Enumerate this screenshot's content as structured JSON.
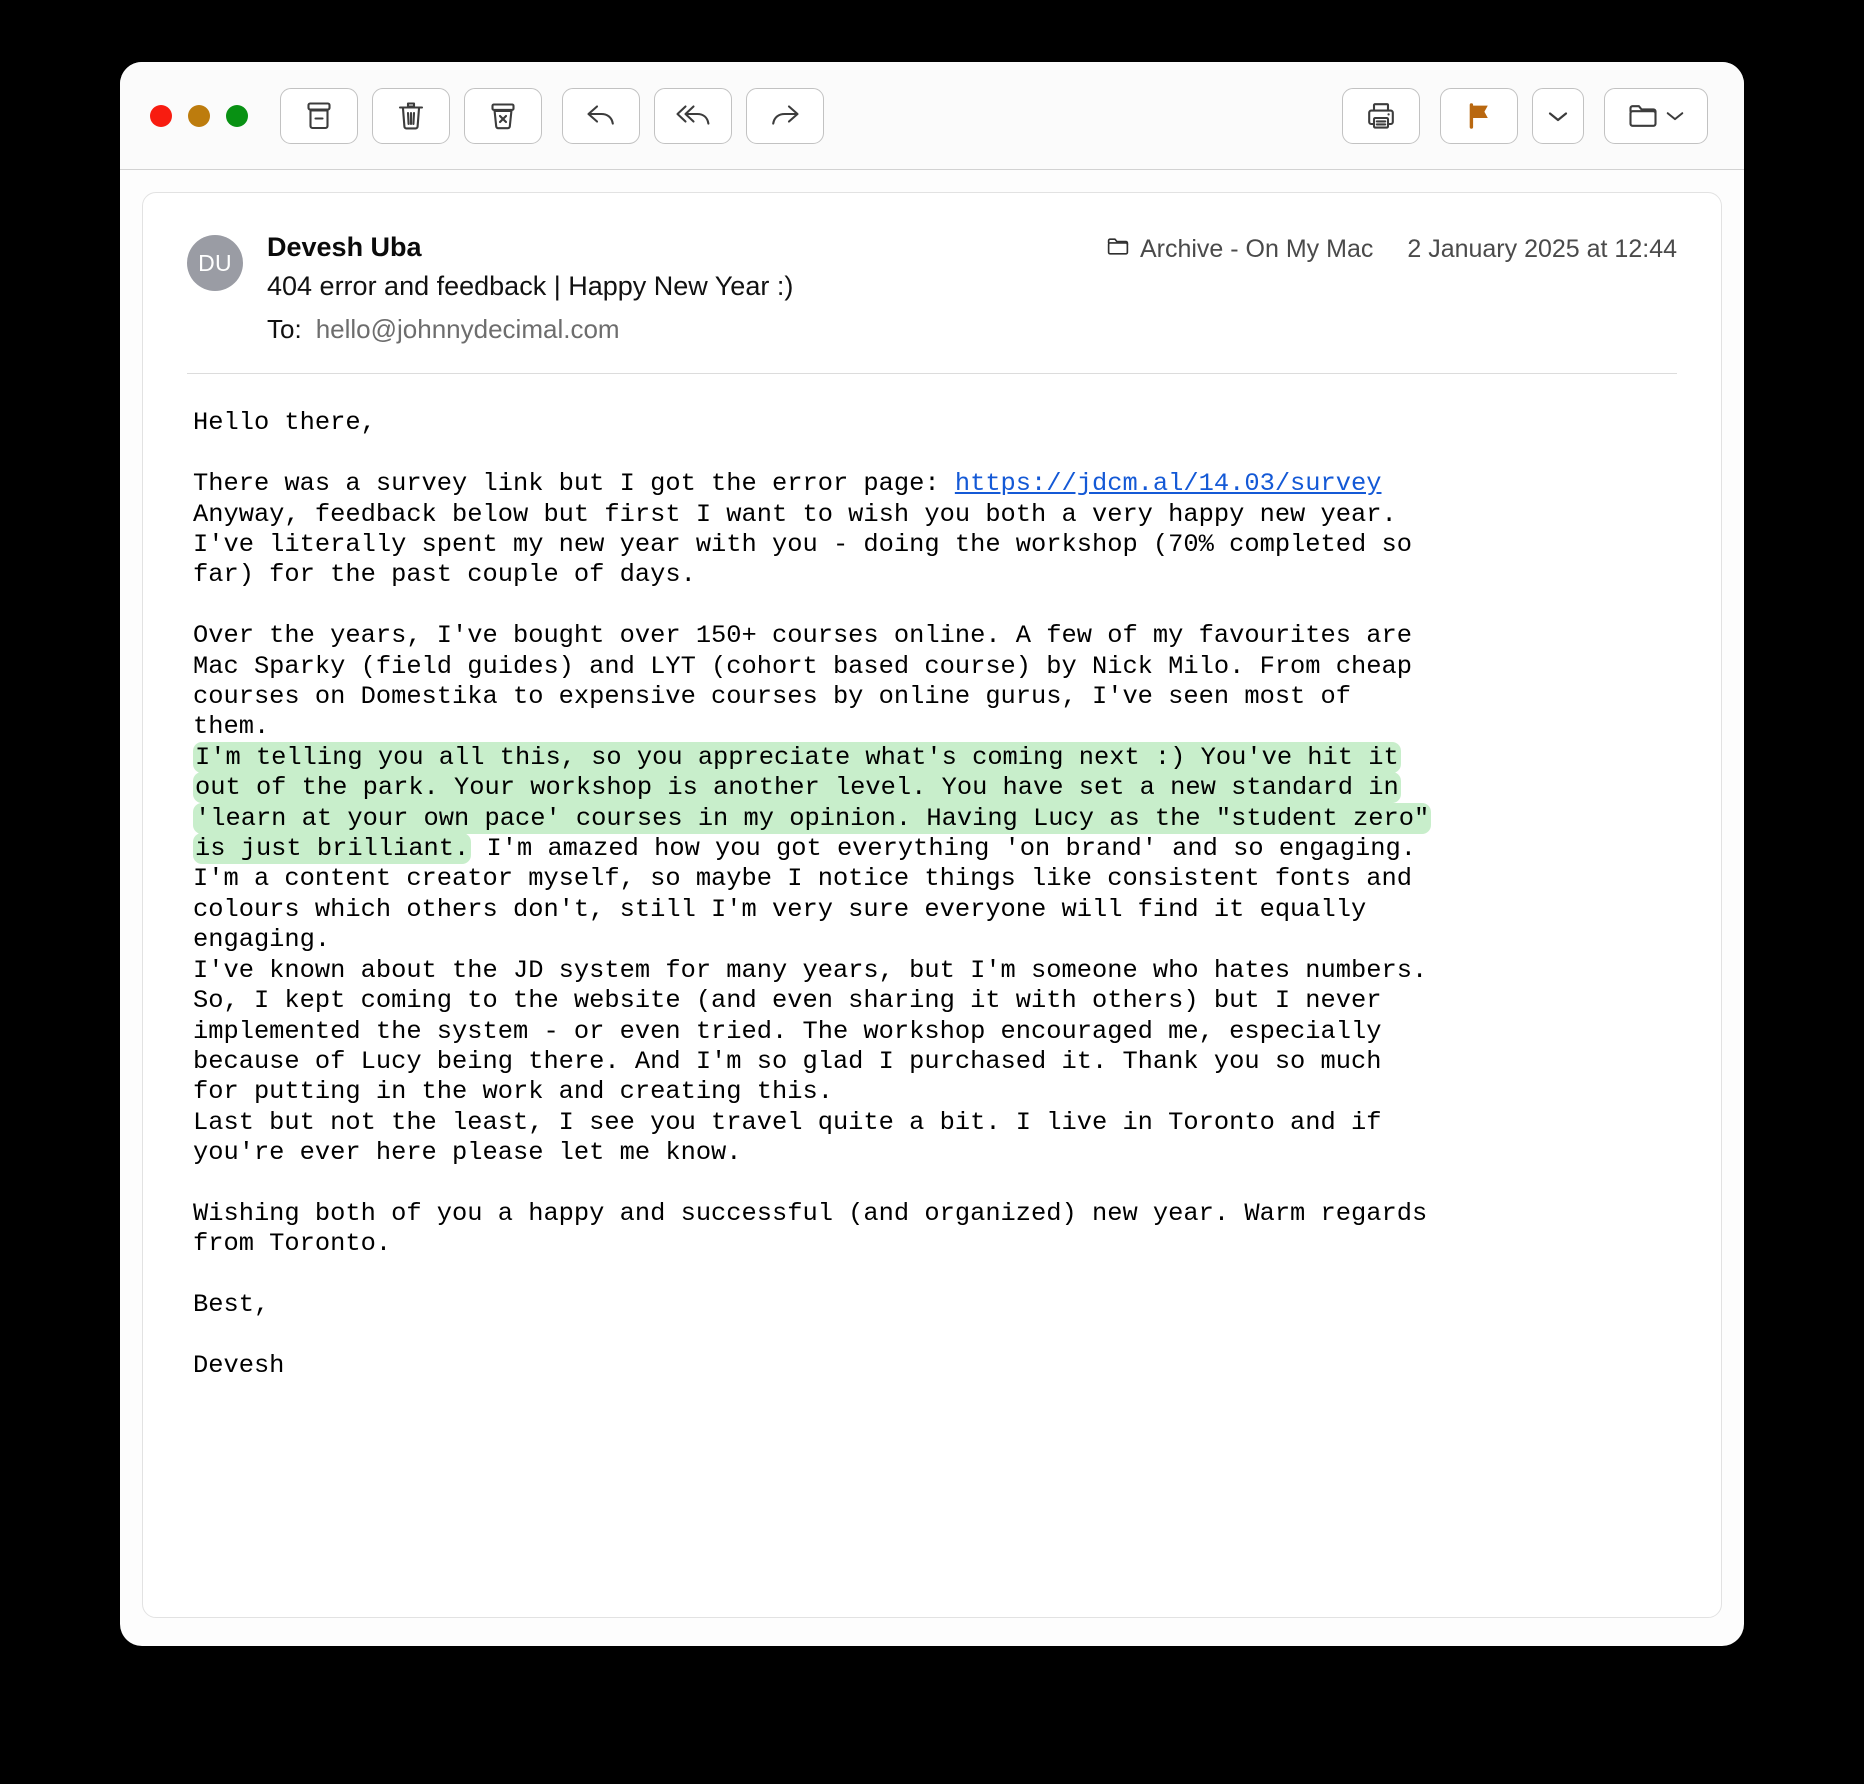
{
  "window": {
    "traffic_lights": [
      "close",
      "minimize",
      "zoom"
    ],
    "colors": {
      "close": "#f81c10",
      "minimize": "#bd7c0d",
      "zoom": "#089113",
      "flag": "#b96810",
      "link": "#1459d6",
      "highlight": "#c8eecb",
      "avatar": "#9a9ca4"
    }
  },
  "toolbar": {
    "left_buttons": [
      {
        "name": "archive",
        "label": "Archive",
        "icon": "archive-box-icon"
      },
      {
        "name": "delete",
        "label": "Delete",
        "icon": "trash-icon"
      },
      {
        "name": "junk",
        "label": "Move to Junk",
        "icon": "junk-bin-icon"
      },
      {
        "name": "reply",
        "label": "Reply",
        "icon": "reply-arrow-icon"
      },
      {
        "name": "reply-all",
        "label": "Reply All",
        "icon": "reply-all-arrow-icon"
      },
      {
        "name": "forward",
        "label": "Forward",
        "icon": "forward-arrow-icon"
      }
    ],
    "right_buttons": [
      {
        "name": "print",
        "label": "Print",
        "icon": "printer-icon"
      },
      {
        "name": "flag",
        "label": "Flag",
        "icon": "flag-icon"
      },
      {
        "name": "flag-menu",
        "label": "Flag options",
        "icon": "chevron-down-icon"
      },
      {
        "name": "move",
        "label": "Move to folder",
        "icon": "folder-icon"
      }
    ]
  },
  "message": {
    "avatar_initials": "DU",
    "sender": "Devesh Uba",
    "subject": "404 error and feedback | Happy New Year :)",
    "to_label": "To:",
    "to_address": "hello@johnnydecimal.com",
    "mailbox": "Archive - On My Mac",
    "mailbox_icon": "folder-icon",
    "date": "2 January 2025 at 12:44",
    "body": {
      "greeting": "Hello there,",
      "para1_before_link": "There was a survey link but I got the error page: ",
      "link_text": "https://jdcm.al/14.03/survey",
      "para1_after_link": "\nAnyway, feedback below but first I want to wish you both a very happy new year.\nI've literally spent my new year with you - doing the workshop (70% completed so\nfar) for the past couple of days.",
      "para2_intro": "Over the years, I've bought over 150+ courses online. A few of my favourites are\nMac Sparky (field guides) and LYT (cohort based course) by Nick Milo. From cheap\ncourses on Domestika to expensive courses by online gurus, I've seen most of\nthem.\n",
      "highlighted": "I'm telling you all this, so you appreciate what's coming next :) You've hit it\nout of the park. Your workshop is another level. You have set a new standard in\n'learn at your own pace' courses in my opinion. Having Lucy as the \"student zero\"\nis just brilliant.",
      "para2_tail": " I'm amazed how you got everything 'on brand' and so engaging.\nI'm a content creator myself, so maybe I notice things like consistent fonts and\ncolours which others don't, still I'm very sure everyone will find it equally\nengaging.\nI've known about the JD system for many years, but I'm someone who hates numbers.\nSo, I kept coming to the website (and even sharing it with others) but I never\nimplemented the system - or even tried. The workshop encouraged me, especially\nbecause of Lucy being there. And I'm so glad I purchased it. Thank you so much\nfor putting in the work and creating this.\nLast but not the least, I see you travel quite a bit. I live in Toronto and if\nyou're ever here please let me know.",
      "closing": "Wishing both of you a happy and successful (and organized) new year. Warm regards\nfrom Toronto.",
      "signoff": "Best,",
      "signature": "Devesh"
    }
  }
}
